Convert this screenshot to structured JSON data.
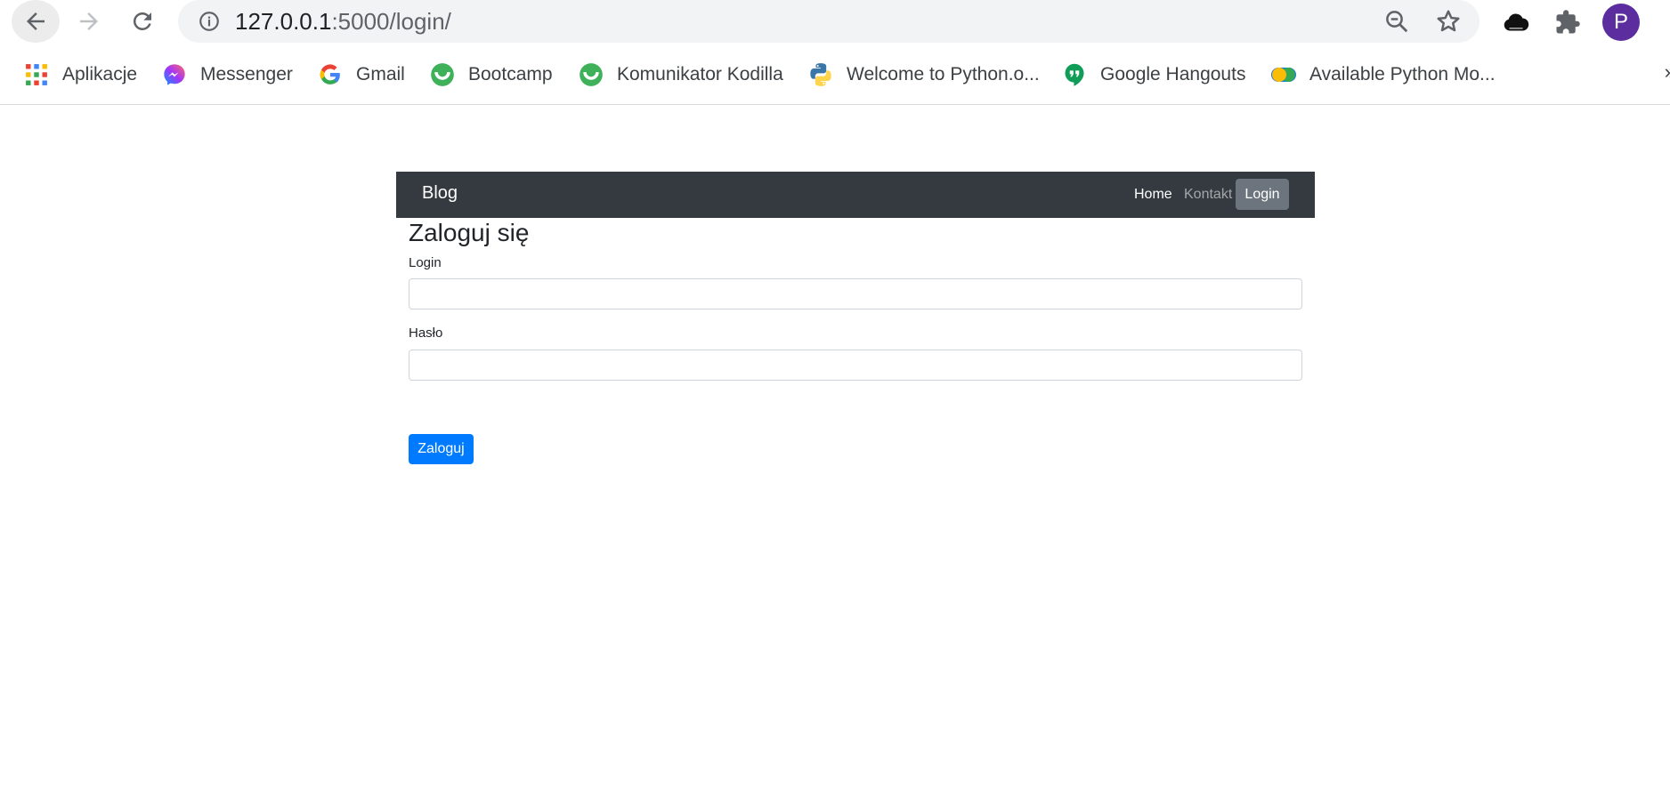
{
  "browser": {
    "url_host": "127.0.0.1",
    "url_rest": ":5000/login/",
    "profile_initial": "P",
    "icons": {
      "back": "arrow-left-icon",
      "forward": "arrow-right-icon",
      "reload": "reload-icon",
      "info": "info-icon",
      "zoom": "zoom-out-icon",
      "bookmark": "star-icon",
      "extension1": "cloud-icon",
      "extensions": "puzzle-icon"
    }
  },
  "bookmarks": [
    {
      "label": "Aplikacje",
      "icon": "apps-grid-icon"
    },
    {
      "label": "Messenger",
      "icon": "messenger-icon"
    },
    {
      "label": "Gmail",
      "icon": "google-g-icon"
    },
    {
      "label": "Bootcamp",
      "icon": "kodilla-icon"
    },
    {
      "label": "Komunikator Kodilla",
      "icon": "kodilla-icon"
    },
    {
      "label": "Welcome to Python.o...",
      "icon": "python-icon"
    },
    {
      "label": "Google Hangouts",
      "icon": "hangouts-icon"
    },
    {
      "label": "Available Python Mo...",
      "icon": "toggle-icon"
    }
  ],
  "page": {
    "brand": "Blog",
    "nav": {
      "home": "Home",
      "kontakt": "Kontakt",
      "login": "Login"
    },
    "title": "Zaloguj się",
    "form": {
      "login_label": "Login",
      "login_value": "",
      "password_label": "Hasło",
      "password_value": "",
      "submit_label": "Zaloguj"
    }
  },
  "colors": {
    "navbar": "#343a40",
    "active_nav": "#6c757d",
    "primary": "#007bff",
    "profile": "#5b2d9e"
  }
}
